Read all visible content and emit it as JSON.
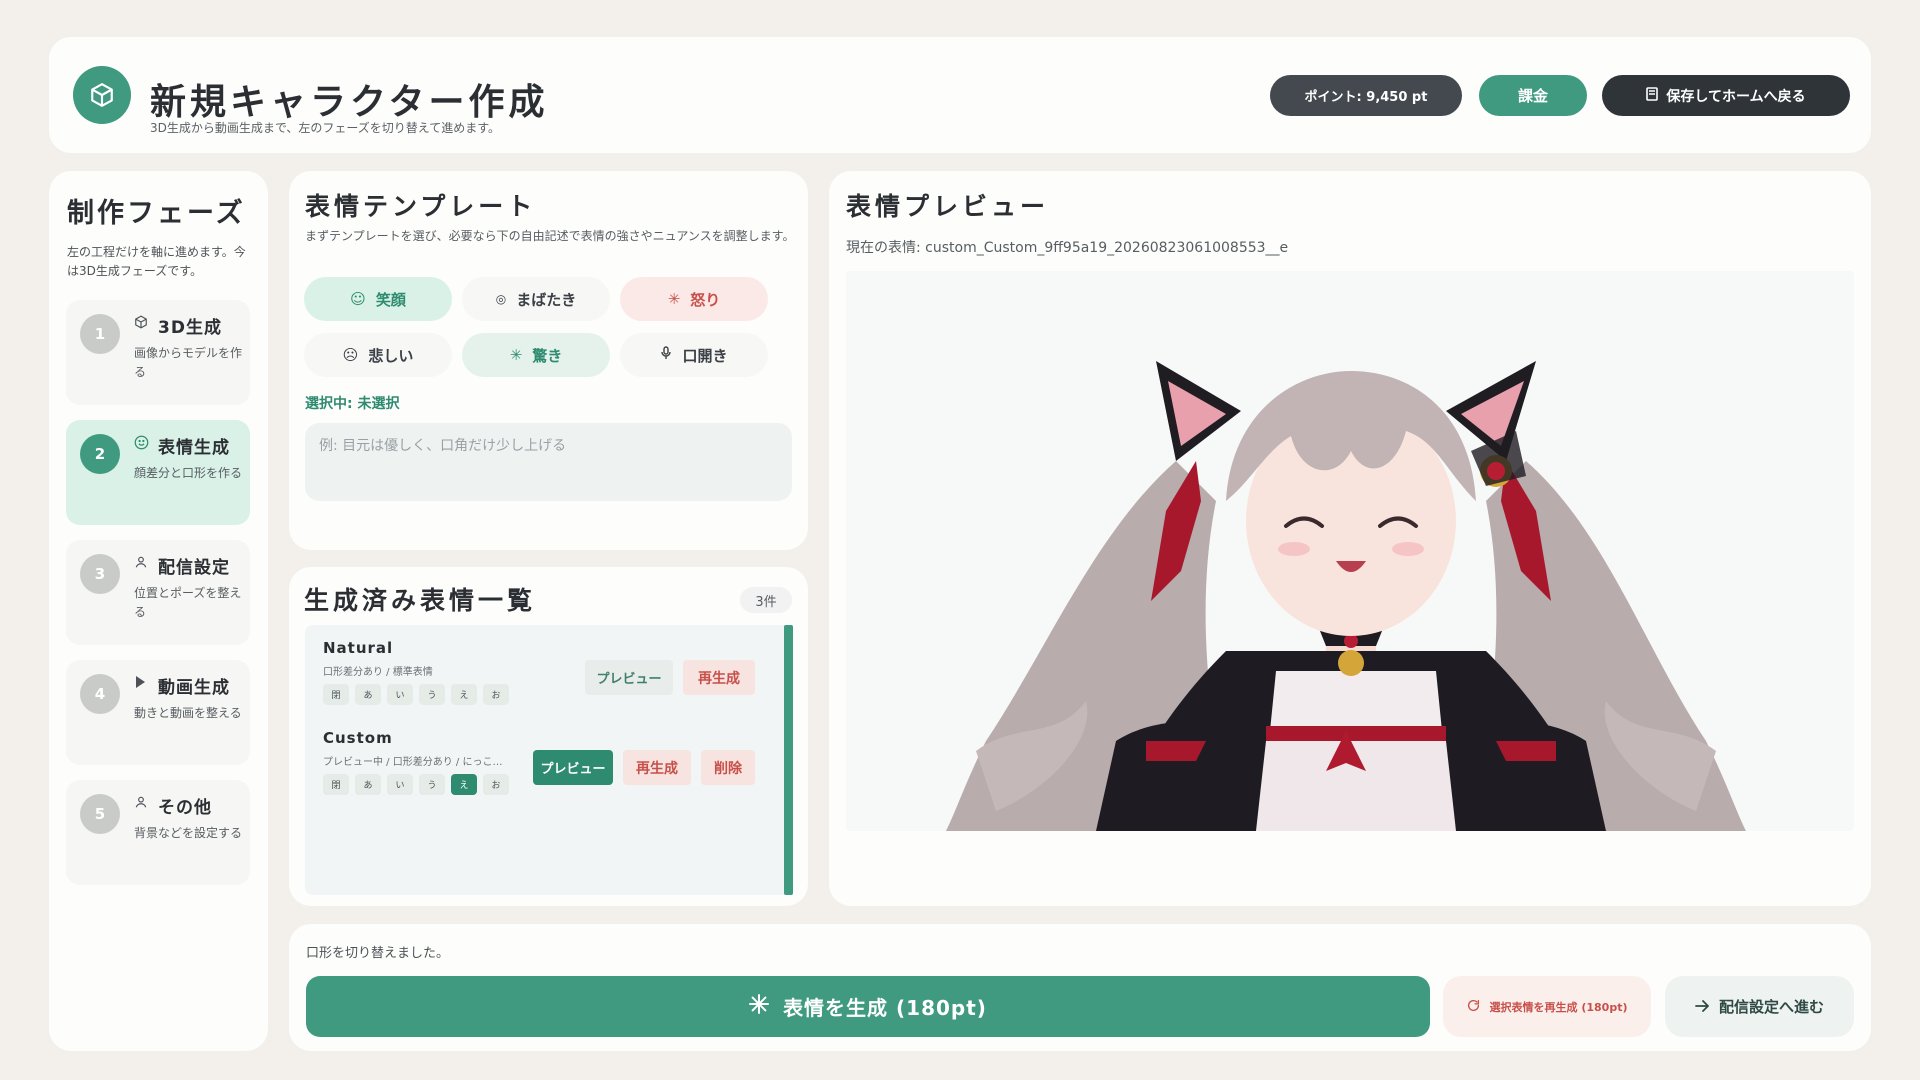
{
  "header": {
    "title": "新規キャラクター作成",
    "subtitle": "3D生成から動画生成まで、左のフェーズを切り替えて進めます。",
    "points_label": "ポイント: 9,450 pt",
    "billing_label": "課金",
    "save_label": "保存してホームへ戻る"
  },
  "phases": {
    "title": "制作フェーズ",
    "desc": "左の工程だけを軸に進めます。今は3D生成フェーズです。",
    "items": [
      {
        "num": "1",
        "name": "3D生成",
        "sub": "画像からモデルを作る",
        "icon": "cube-icon"
      },
      {
        "num": "2",
        "name": "表情生成",
        "sub": "顔差分と口形を作る",
        "icon": "smile-icon"
      },
      {
        "num": "3",
        "name": "配信設定",
        "sub": "位置とポーズを整える",
        "icon": "person-icon"
      },
      {
        "num": "4",
        "name": "動画生成",
        "sub": "動きと動画を整える",
        "icon": "play-icon"
      },
      {
        "num": "5",
        "name": "その他",
        "sub": "背景などを設定する",
        "icon": "person-icon"
      }
    ]
  },
  "templates": {
    "title": "表情テンプレート",
    "desc": "まずテンプレートを選び、必要なら下の自由記述で表情の強さやニュアンスを調整します。",
    "chips": [
      {
        "label": "笑顔",
        "icon": "☺"
      },
      {
        "label": "まばたき",
        "icon": "◎"
      },
      {
        "label": "怒り",
        "icon": "✳"
      },
      {
        "label": "悲しい",
        "icon": "☹"
      },
      {
        "label": "驚き",
        "icon": "✳"
      },
      {
        "label": "口開き",
        "icon": "🎙"
      }
    ],
    "selected": "選択中: 未選択",
    "placeholder": "例: 目元は優しく、口角だけ少し上げる"
  },
  "generated": {
    "title": "生成済み表情一覧",
    "count": "3件",
    "items": [
      {
        "name": "Natural",
        "sub": "口形差分あり / 標準表情",
        "mouths": [
          "閉",
          "あ",
          "い",
          "う",
          "え",
          "お"
        ],
        "preview": "プレビュー",
        "regen": "再生成"
      },
      {
        "name": "Custom",
        "sub": "プレビュー中 / 口形差分あり / にっこ…",
        "mouths": [
          "閉",
          "あ",
          "い",
          "う",
          "え",
          "お"
        ],
        "preview": "プレビュー",
        "regen": "再生成",
        "delete": "削除"
      }
    ]
  },
  "preview": {
    "title": "表情プレビュー",
    "current": "現在の表情: custom_Custom_9ff95a19_20260823061008553__e"
  },
  "actions": {
    "status": "口形を切り替えました。",
    "generate": "表情を生成 (180pt)",
    "regen_selected": "選択表情を再生成 (180pt)",
    "next": "配信設定へ進む"
  },
  "colors": {
    "accent": "#3f9a80",
    "accent_light": "#d9f1e7",
    "danger": "#c8504a",
    "dark": "#2f3439",
    "background": "#f3efea"
  }
}
